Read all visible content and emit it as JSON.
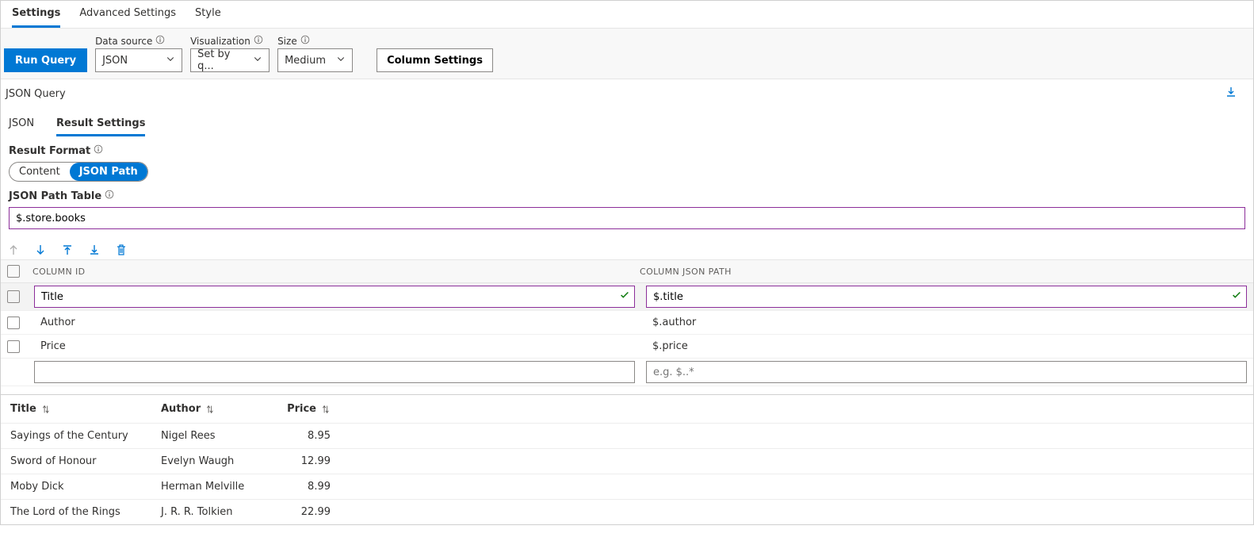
{
  "mainTabs": {
    "t0": "Settings",
    "t1": "Advanced Settings",
    "t2": "Style"
  },
  "toolbar": {
    "run": "Run Query",
    "dataSourceLabel": "Data source",
    "dataSourceValue": "JSON",
    "visualizationLabel": "Visualization",
    "visualizationValue": "Set by q...",
    "sizeLabel": "Size",
    "sizeValue": "Medium",
    "columnSettings": "Column Settings"
  },
  "sectionTitle": "JSON Query",
  "subTabs": {
    "json": "JSON",
    "result": "Result Settings"
  },
  "resultFormat": {
    "label": "Result Format",
    "opt1": "Content",
    "opt2": "JSON Path"
  },
  "pathTable": {
    "label": "JSON Path Table",
    "value": "$.store.books"
  },
  "colHeader": {
    "h1": "COLUMN ID",
    "h2": "COLUMN JSON PATH"
  },
  "cols": [
    {
      "id": "Title",
      "path": "$.title"
    },
    {
      "id": "Author",
      "path": "$.author"
    },
    {
      "id": "Price",
      "path": "$.price"
    }
  ],
  "blankPlaceholder": "e.g. $..*",
  "resultHeaders": {
    "title": "Title",
    "author": "Author",
    "price": "Price"
  },
  "rows": [
    {
      "title": "Sayings of the Century",
      "author": "Nigel Rees",
      "price": "8.95"
    },
    {
      "title": "Sword of Honour",
      "author": "Evelyn Waugh",
      "price": "12.99"
    },
    {
      "title": "Moby Dick",
      "author": "Herman Melville",
      "price": "8.99"
    },
    {
      "title": "The Lord of the Rings",
      "author": "J. R. R. Tolkien",
      "price": "22.99"
    }
  ]
}
